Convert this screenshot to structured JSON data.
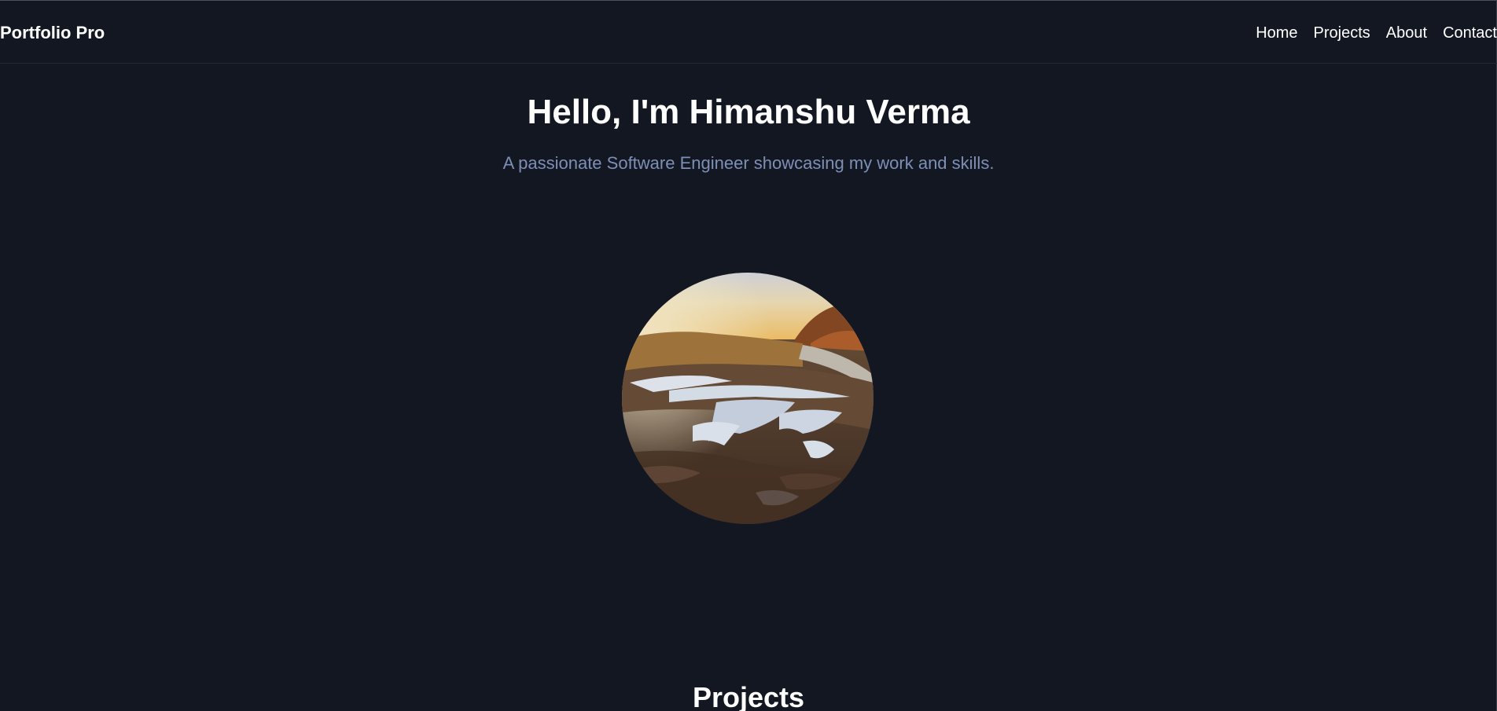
{
  "navbar": {
    "brand": "Portfolio Pro",
    "links": [
      {
        "label": "Home"
      },
      {
        "label": "Projects"
      },
      {
        "label": "About"
      },
      {
        "label": "Contact"
      }
    ]
  },
  "hero": {
    "title": "Hello, I'm Himanshu Verma",
    "subtitle": "A passionate Software Engineer showcasing my work and skills.",
    "image": "profile-photo-landscape"
  },
  "sections": {
    "projects_title": "Projects"
  },
  "colors": {
    "background": "#121722",
    "text": "#ffffff",
    "subtitle": "#7e8fb6"
  }
}
